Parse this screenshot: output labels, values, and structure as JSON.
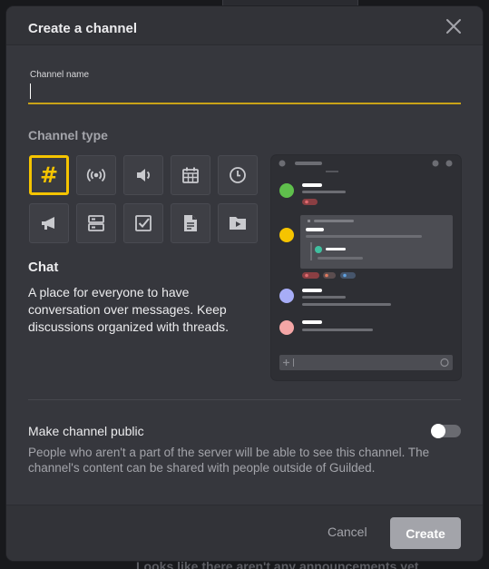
{
  "dialog": {
    "title": "Create a channel",
    "close_icon": "close-icon"
  },
  "name_field": {
    "label": "Channel name",
    "value": "",
    "accent_color": "#c9a318"
  },
  "channel_type": {
    "label": "Channel type",
    "selected": "chat",
    "types": [
      {
        "id": "chat",
        "icon": "hash-icon",
        "glyph": "#"
      },
      {
        "id": "voice",
        "icon": "broadcast-icon"
      },
      {
        "id": "stream",
        "icon": "speaker-icon"
      },
      {
        "id": "calendar",
        "icon": "calendar-icon"
      },
      {
        "id": "scheduling",
        "icon": "clock-icon"
      },
      {
        "id": "announcements",
        "icon": "megaphone-icon"
      },
      {
        "id": "list",
        "icon": "list-icon"
      },
      {
        "id": "checklist",
        "icon": "checkbox-icon"
      },
      {
        "id": "docs",
        "icon": "document-icon"
      },
      {
        "id": "media",
        "icon": "media-icon"
      }
    ],
    "selected_color": "#f5c400"
  },
  "selected_info": {
    "title": "Chat",
    "description": "A place for everyone to have conversation over messages. Keep discussions organized with threads."
  },
  "preview": {
    "avatar_colors": [
      "#5fbf4c",
      "#f5c400",
      "#a7adf7",
      "#f4a6a6"
    ]
  },
  "public": {
    "label": "Make channel public",
    "enabled": false,
    "description": "People who aren't a part of the server will be able to see this channel. The channel's content can be shared with people outside of Guilded."
  },
  "footer": {
    "cancel_label": "Cancel",
    "create_label": "Create"
  },
  "background": {
    "text": "Looks like there aren't any announcements yet"
  }
}
